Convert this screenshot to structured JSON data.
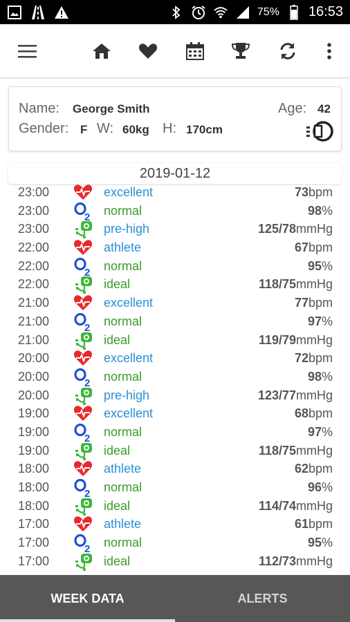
{
  "status_bar": {
    "battery": "75%",
    "time": "16:53"
  },
  "toolbar": {
    "icons": [
      "menu-icon",
      "home-icon",
      "heart-icon",
      "calendar-icon",
      "trophy-icon",
      "refresh-icon",
      "more-vert-icon"
    ]
  },
  "profile": {
    "name_label": "Name:",
    "name": "George Smith",
    "age_label": "Age:",
    "age": "42",
    "gender_label": "Gender:",
    "gender": "F",
    "weight_label": "W:",
    "weight": "60kg",
    "height_label": "H:",
    "height": "170cm"
  },
  "date": "2019-01-12",
  "colors": {
    "heart": "#e8292f",
    "o2": "#1f4fd6",
    "bp": "#3cb83c",
    "status_blue": "#2a8fd6",
    "status_green": "#3b9a2b"
  },
  "rows": [
    {
      "time": "23:00",
      "type": "heart",
      "status": "excellent",
      "value": "73",
      "unit": "bpm"
    },
    {
      "time": "23:00",
      "type": "o2",
      "status": "normal",
      "value": "98",
      "unit": "%"
    },
    {
      "time": "23:00",
      "type": "bp",
      "status": "pre-high",
      "value": "125/78",
      "unit": "mmHg"
    },
    {
      "time": "22:00",
      "type": "heart",
      "status": "athlete",
      "value": "67",
      "unit": "bpm"
    },
    {
      "time": "22:00",
      "type": "o2",
      "status": "normal",
      "value": "95",
      "unit": "%"
    },
    {
      "time": "22:00",
      "type": "bp",
      "status": "ideal",
      "value": "118/75",
      "unit": "mmHg"
    },
    {
      "time": "21:00",
      "type": "heart",
      "status": "excellent",
      "value": "77",
      "unit": "bpm"
    },
    {
      "time": "21:00",
      "type": "o2",
      "status": "normal",
      "value": "97",
      "unit": "%"
    },
    {
      "time": "21:00",
      "type": "bp",
      "status": "ideal",
      "value": "119/79",
      "unit": "mmHg"
    },
    {
      "time": "20:00",
      "type": "heart",
      "status": "excellent",
      "value": "72",
      "unit": "bpm"
    },
    {
      "time": "20:00",
      "type": "o2",
      "status": "normal",
      "value": "98",
      "unit": "%"
    },
    {
      "time": "20:00",
      "type": "bp",
      "status": "pre-high",
      "value": "123/77",
      "unit": "mmHg"
    },
    {
      "time": "19:00",
      "type": "heart",
      "status": "excellent",
      "value": "68",
      "unit": "bpm"
    },
    {
      "time": "19:00",
      "type": "o2",
      "status": "normal",
      "value": "97",
      "unit": "%"
    },
    {
      "time": "19:00",
      "type": "bp",
      "status": "ideal",
      "value": "118/75",
      "unit": "mmHg"
    },
    {
      "time": "18:00",
      "type": "heart",
      "status": "athlete",
      "value": "62",
      "unit": "bpm"
    },
    {
      "time": "18:00",
      "type": "o2",
      "status": "normal",
      "value": "96",
      "unit": "%"
    },
    {
      "time": "18:00",
      "type": "bp",
      "status": "ideal",
      "value": "114/74",
      "unit": "mmHg"
    },
    {
      "time": "17:00",
      "type": "heart",
      "status": "athlete",
      "value": "61",
      "unit": "bpm"
    },
    {
      "time": "17:00",
      "type": "o2",
      "status": "normal",
      "value": "95",
      "unit": "%"
    },
    {
      "time": "17:00",
      "type": "bp",
      "status": "ideal",
      "value": "112/73",
      "unit": "mmHg"
    }
  ],
  "tabs": [
    {
      "label": "WEEK DATA",
      "active": true
    },
    {
      "label": "ALERTS",
      "active": false
    }
  ]
}
